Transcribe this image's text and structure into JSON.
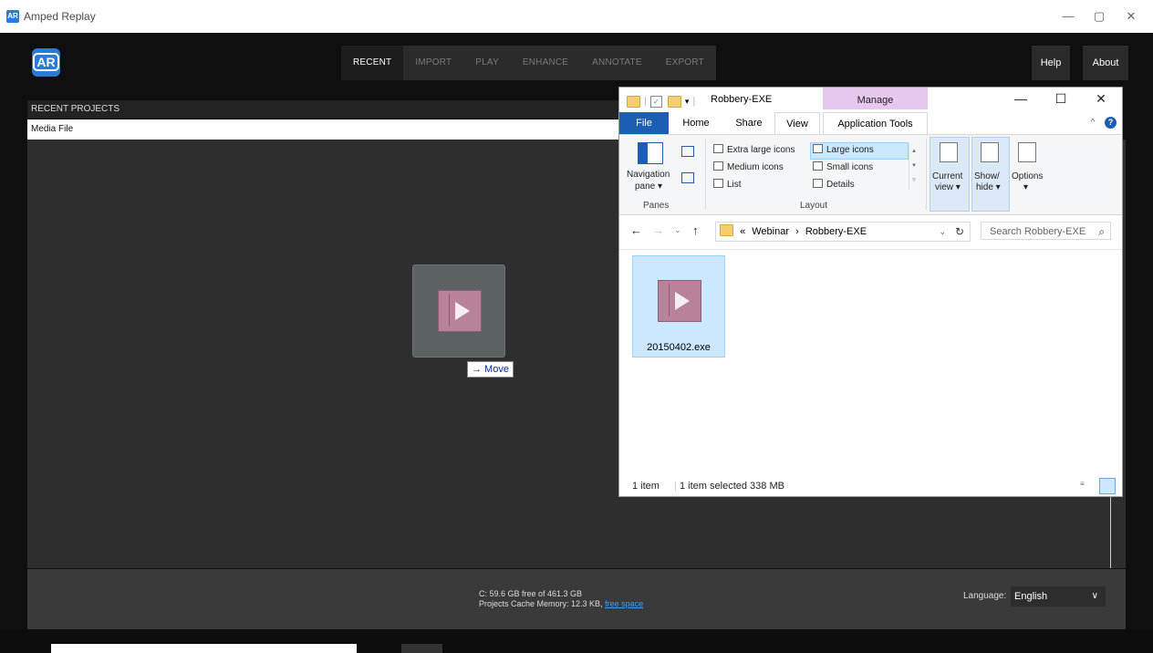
{
  "window": {
    "icon_text": "AR",
    "title": "Amped Replay",
    "minimize": "—",
    "maximize": "▢",
    "close": "✕"
  },
  "app": {
    "logo_text": "AR",
    "nav": [
      "RECENT",
      "IMPORT",
      "PLAY",
      "ENHANCE",
      "ANNOTATE",
      "EXPORT"
    ],
    "active_tab": "RECENT",
    "help_label": "Help",
    "about_label": "About",
    "panel_title": "RECENT PROJECTS",
    "media_file_label": "Media File",
    "drag_tooltip": "→ Move",
    "disk_free": "C: 59.6 GB free of 461.3 GB",
    "cache_prefix": "Projects Cache Memory: 12.3 KB,",
    "free_space_link": "free space",
    "language_label": "Language:",
    "language_value": "English",
    "chevron_icon": "chevron-down-icon"
  },
  "explorer": {
    "title": "Robbery-EXE",
    "manage_label": "Manage",
    "minimize": "—",
    "maximize": "☐",
    "close": "✕",
    "tabs": {
      "file": "File",
      "home": "Home",
      "share": "Share",
      "view": "View",
      "application_tools": "Application Tools"
    },
    "help_icon": "?",
    "ribbon": {
      "navigation_pane": "Navigation",
      "navigation_pane_2": "pane ▾",
      "panes_label": "Panes",
      "extra_large_icons": "Extra large icons",
      "large_icons": "Large icons",
      "medium_icons": "Medium icons",
      "small_icons": "Small icons",
      "list": "List",
      "details": "Details",
      "layout_label": "Layout",
      "current_view": "Current",
      "current_view_2": "view ▾",
      "show_hide": "Show/",
      "show_hide_2": "hide ▾",
      "options": "Options",
      "options_2": "▾"
    },
    "address": {
      "crumb_prefix": "«",
      "crumb_1": "Webinar",
      "separator": "›",
      "crumb_2": "Robbery-EXE",
      "search_placeholder": "Search Robbery-EXE"
    },
    "file": {
      "name": "20150402.exe"
    },
    "status": {
      "items": "1 item",
      "selected": "1 item selected  338 MB"
    }
  }
}
